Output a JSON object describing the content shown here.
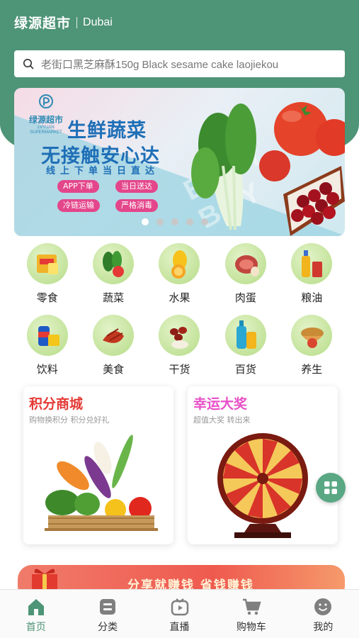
{
  "header": {
    "app_name": "绿源超市",
    "city": "Dubai",
    "brand_color": "#4e9477"
  },
  "search": {
    "placeholder": "老街口黑芝麻酥150g Black sesame cake laojiekou",
    "icon": "search-icon"
  },
  "banner": {
    "logo_cn": "绿源超市",
    "logo_en": "LVYUAN SUPERMARKET",
    "title_line1": "生鲜蔬菜",
    "title_line2": "无接触安心达",
    "subtitle": "线上下单当日直达",
    "tags": [
      "APP下单",
      "当日送达",
      "冷链运输",
      "严格消毒"
    ],
    "watermark": "EASY BUY",
    "slide_count": 5,
    "active_slide": 1
  },
  "categories": [
    {
      "label": "零食",
      "icon": "snacks-icon"
    },
    {
      "label": "蔬菜",
      "icon": "vegetables-icon"
    },
    {
      "label": "水果",
      "icon": "fruit-icon"
    },
    {
      "label": "肉蛋",
      "icon": "meat-eggs-icon"
    },
    {
      "label": "粮油",
      "icon": "grain-oil-icon"
    },
    {
      "label": "饮料",
      "icon": "drinks-icon"
    },
    {
      "label": "美食",
      "icon": "cuisine-icon"
    },
    {
      "label": "干货",
      "icon": "dried-goods-icon"
    },
    {
      "label": "百货",
      "icon": "household-icon"
    },
    {
      "label": "养生",
      "icon": "health-icon"
    }
  ],
  "promos": {
    "points_mall": {
      "title": "积分商城",
      "subtitle": "购物换积分 积分兑好礼",
      "title_color": "#e53935"
    },
    "lucky_draw": {
      "title": "幸运大奖",
      "subtitle": "超值大奖 转出来",
      "title_color": "#e84fc8"
    }
  },
  "bottom_banner": {
    "text": "分享就赚钱 省钱赚钱"
  },
  "tabbar": [
    {
      "label": "首页",
      "icon": "home-icon",
      "active": true
    },
    {
      "label": "分类",
      "icon": "category-icon",
      "active": false
    },
    {
      "label": "直播",
      "icon": "live-icon",
      "active": false
    },
    {
      "label": "购物车",
      "icon": "cart-icon",
      "active": false
    },
    {
      "label": "我的",
      "icon": "profile-icon",
      "active": false
    }
  ]
}
